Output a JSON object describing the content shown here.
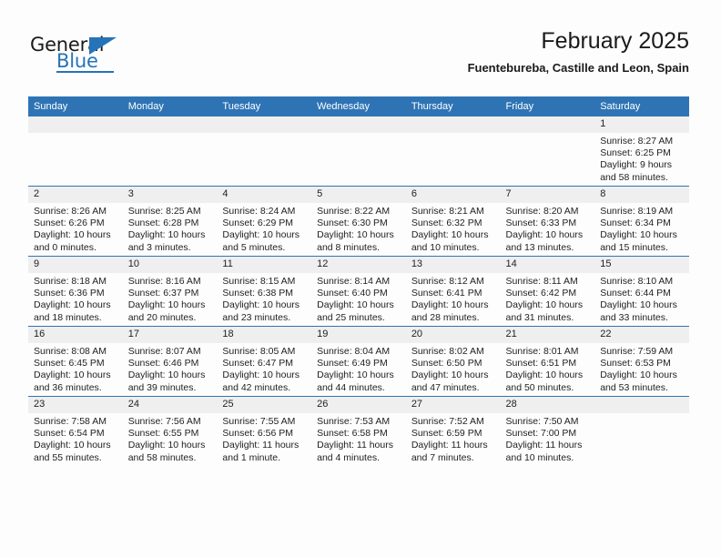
{
  "brand": {
    "name_part1": "General",
    "name_part2": "Blue",
    "accent_color": "#2574b8"
  },
  "header": {
    "title": "February 2025",
    "subtitle": "Fuentebureba, Castille and Leon, Spain",
    "header_bg_color": "#2e74b5",
    "daynum_bg_color": "#efefef"
  },
  "weekday_headers": [
    "Sunday",
    "Monday",
    "Tuesday",
    "Wednesday",
    "Thursday",
    "Friday",
    "Saturday"
  ],
  "weeks": [
    [
      {
        "day": "",
        "sunrise": "",
        "sunset": "",
        "daylight": "",
        "empty": true
      },
      {
        "day": "",
        "sunrise": "",
        "sunset": "",
        "daylight": "",
        "empty": true
      },
      {
        "day": "",
        "sunrise": "",
        "sunset": "",
        "daylight": "",
        "empty": true
      },
      {
        "day": "",
        "sunrise": "",
        "sunset": "",
        "daylight": "",
        "empty": true
      },
      {
        "day": "",
        "sunrise": "",
        "sunset": "",
        "daylight": "",
        "empty": true
      },
      {
        "day": "",
        "sunrise": "",
        "sunset": "",
        "daylight": "",
        "empty": true
      },
      {
        "day": "1",
        "sunrise": "Sunrise: 8:27 AM",
        "sunset": "Sunset: 6:25 PM",
        "daylight": "Daylight: 9 hours and 58 minutes."
      }
    ],
    [
      {
        "day": "2",
        "sunrise": "Sunrise: 8:26 AM",
        "sunset": "Sunset: 6:26 PM",
        "daylight": "Daylight: 10 hours and 0 minutes."
      },
      {
        "day": "3",
        "sunrise": "Sunrise: 8:25 AM",
        "sunset": "Sunset: 6:28 PM",
        "daylight": "Daylight: 10 hours and 3 minutes."
      },
      {
        "day": "4",
        "sunrise": "Sunrise: 8:24 AM",
        "sunset": "Sunset: 6:29 PM",
        "daylight": "Daylight: 10 hours and 5 minutes."
      },
      {
        "day": "5",
        "sunrise": "Sunrise: 8:22 AM",
        "sunset": "Sunset: 6:30 PM",
        "daylight": "Daylight: 10 hours and 8 minutes."
      },
      {
        "day": "6",
        "sunrise": "Sunrise: 8:21 AM",
        "sunset": "Sunset: 6:32 PM",
        "daylight": "Daylight: 10 hours and 10 minutes."
      },
      {
        "day": "7",
        "sunrise": "Sunrise: 8:20 AM",
        "sunset": "Sunset: 6:33 PM",
        "daylight": "Daylight: 10 hours and 13 minutes."
      },
      {
        "day": "8",
        "sunrise": "Sunrise: 8:19 AM",
        "sunset": "Sunset: 6:34 PM",
        "daylight": "Daylight: 10 hours and 15 minutes."
      }
    ],
    [
      {
        "day": "9",
        "sunrise": "Sunrise: 8:18 AM",
        "sunset": "Sunset: 6:36 PM",
        "daylight": "Daylight: 10 hours and 18 minutes."
      },
      {
        "day": "10",
        "sunrise": "Sunrise: 8:16 AM",
        "sunset": "Sunset: 6:37 PM",
        "daylight": "Daylight: 10 hours and 20 minutes."
      },
      {
        "day": "11",
        "sunrise": "Sunrise: 8:15 AM",
        "sunset": "Sunset: 6:38 PM",
        "daylight": "Daylight: 10 hours and 23 minutes."
      },
      {
        "day": "12",
        "sunrise": "Sunrise: 8:14 AM",
        "sunset": "Sunset: 6:40 PM",
        "daylight": "Daylight: 10 hours and 25 minutes."
      },
      {
        "day": "13",
        "sunrise": "Sunrise: 8:12 AM",
        "sunset": "Sunset: 6:41 PM",
        "daylight": "Daylight: 10 hours and 28 minutes."
      },
      {
        "day": "14",
        "sunrise": "Sunrise: 8:11 AM",
        "sunset": "Sunset: 6:42 PM",
        "daylight": "Daylight: 10 hours and 31 minutes."
      },
      {
        "day": "15",
        "sunrise": "Sunrise: 8:10 AM",
        "sunset": "Sunset: 6:44 PM",
        "daylight": "Daylight: 10 hours and 33 minutes."
      }
    ],
    [
      {
        "day": "16",
        "sunrise": "Sunrise: 8:08 AM",
        "sunset": "Sunset: 6:45 PM",
        "daylight": "Daylight: 10 hours and 36 minutes."
      },
      {
        "day": "17",
        "sunrise": "Sunrise: 8:07 AM",
        "sunset": "Sunset: 6:46 PM",
        "daylight": "Daylight: 10 hours and 39 minutes."
      },
      {
        "day": "18",
        "sunrise": "Sunrise: 8:05 AM",
        "sunset": "Sunset: 6:47 PM",
        "daylight": "Daylight: 10 hours and 42 minutes."
      },
      {
        "day": "19",
        "sunrise": "Sunrise: 8:04 AM",
        "sunset": "Sunset: 6:49 PM",
        "daylight": "Daylight: 10 hours and 44 minutes."
      },
      {
        "day": "20",
        "sunrise": "Sunrise: 8:02 AM",
        "sunset": "Sunset: 6:50 PM",
        "daylight": "Daylight: 10 hours and 47 minutes."
      },
      {
        "day": "21",
        "sunrise": "Sunrise: 8:01 AM",
        "sunset": "Sunset: 6:51 PM",
        "daylight": "Daylight: 10 hours and 50 minutes."
      },
      {
        "day": "22",
        "sunrise": "Sunrise: 7:59 AM",
        "sunset": "Sunset: 6:53 PM",
        "daylight": "Daylight: 10 hours and 53 minutes."
      }
    ],
    [
      {
        "day": "23",
        "sunrise": "Sunrise: 7:58 AM",
        "sunset": "Sunset: 6:54 PM",
        "daylight": "Daylight: 10 hours and 55 minutes."
      },
      {
        "day": "24",
        "sunrise": "Sunrise: 7:56 AM",
        "sunset": "Sunset: 6:55 PM",
        "daylight": "Daylight: 10 hours and 58 minutes."
      },
      {
        "day": "25",
        "sunrise": "Sunrise: 7:55 AM",
        "sunset": "Sunset: 6:56 PM",
        "daylight": "Daylight: 11 hours and 1 minute."
      },
      {
        "day": "26",
        "sunrise": "Sunrise: 7:53 AM",
        "sunset": "Sunset: 6:58 PM",
        "daylight": "Daylight: 11 hours and 4 minutes."
      },
      {
        "day": "27",
        "sunrise": "Sunrise: 7:52 AM",
        "sunset": "Sunset: 6:59 PM",
        "daylight": "Daylight: 11 hours and 7 minutes."
      },
      {
        "day": "28",
        "sunrise": "Sunrise: 7:50 AM",
        "sunset": "Sunset: 7:00 PM",
        "daylight": "Daylight: 11 hours and 10 minutes."
      },
      {
        "day": "",
        "sunrise": "",
        "sunset": "",
        "daylight": "",
        "empty": true
      }
    ]
  ]
}
